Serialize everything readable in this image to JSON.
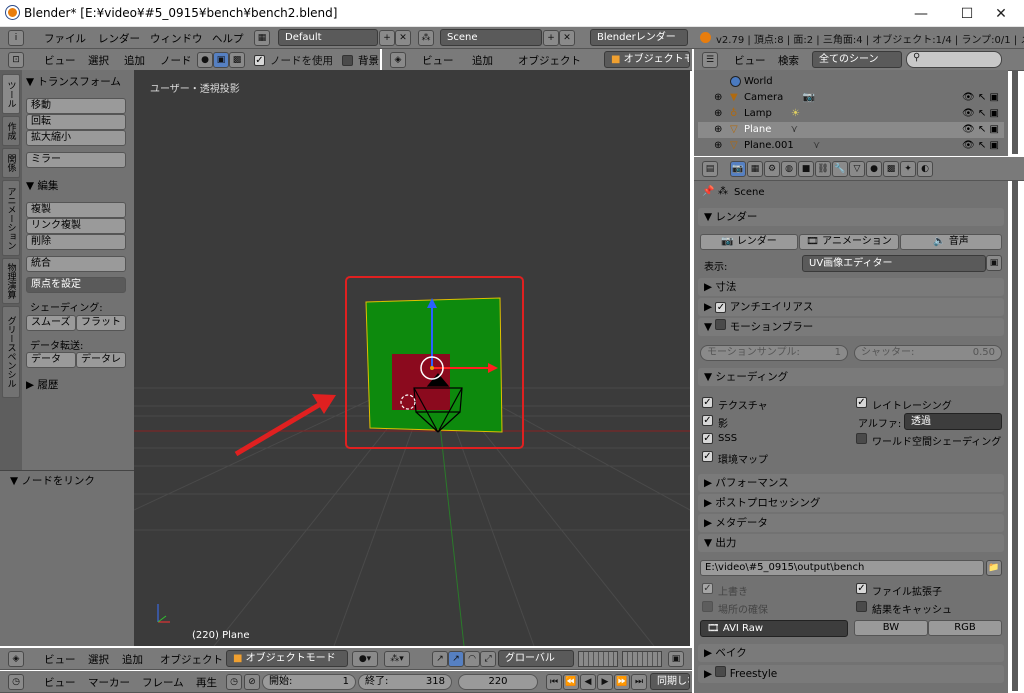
{
  "window": {
    "title": "Blender* [E:¥video¥#5_0915¥bench¥bench2.blend]",
    "minimize": "—",
    "maximize": "☐",
    "close": "✕"
  },
  "infobar": {
    "menus": [
      "ファイル",
      "レンダー",
      "ウィンドウ",
      "ヘルプ"
    ],
    "layout": "Default",
    "scene": "Scene",
    "engine": "Blenderレンダー",
    "stats": "v2.79 | 頂点:8 | 面:2 | 三角面:4 | オブジェクト:1/4 | ランプ:0/1 | メモリ:"
  },
  "node_header": {
    "menus": [
      "ビュー",
      "選択",
      "追加",
      "ノード"
    ],
    "use_nodes_label": "ノードを使用",
    "background_label": "背景"
  },
  "view3d_header_top": {
    "menus": [
      "ビュー",
      "追加",
      "オブジェクト"
    ],
    "mode": "オブジェクトモ"
  },
  "outliner_header": {
    "menus": [
      "ビュー",
      "検索"
    ],
    "filter": "全てのシーン"
  },
  "outliner": {
    "items": [
      {
        "name": "World"
      },
      {
        "name": "Camera"
      },
      {
        "name": "Lamp"
      },
      {
        "name": "Plane"
      },
      {
        "name": "Plane.001"
      }
    ]
  },
  "tool_tabs": [
    "ツール",
    "作成",
    "関係",
    "アニメーション",
    "物理演算",
    "グリースペンシル"
  ],
  "tool_panel": {
    "transform_title": "トランスフォーム",
    "move": "移動",
    "rotate": "回転",
    "scale": "拡大縮小",
    "mirror": "ミラー",
    "edit_title": "編集",
    "duplicate": "複製",
    "link_duplicate": "リンク複製",
    "delete": "削除",
    "join": "統合",
    "set_origin": "原点を設定",
    "shading_label": "シェーディング:",
    "smooth": "スムーズ",
    "flat": "フラット",
    "data_transfer_label": "データ転送:",
    "data": "データ",
    "data_layout": "データレ",
    "history_title": "履歴",
    "link_nodes_title": "ノードをリンク"
  },
  "viewport": {
    "view_label": "ユーザー・透視投影",
    "object_label": "(220) Plane"
  },
  "props": {
    "context": "Scene",
    "render_title": "レンダー",
    "render_btn": "レンダー",
    "anim_btn": "アニメーション",
    "audio_btn": "音声",
    "display_label": "表示:",
    "display_value": "UV画像エディター",
    "dimensions": "寸法",
    "antialias": "アンチエイリアス",
    "motion_blur": "モーションブラー",
    "motion_samples_label": "モーションサンプル:",
    "motion_samples_value": "1",
    "shutter_label": "シャッター:",
    "shutter_value": "0.50",
    "shading": "シェーディング",
    "textures": "テクスチャ",
    "raytracing": "レイトレーシング",
    "shadows": "影",
    "alpha_label": "アルファ:",
    "alpha_value": "透過",
    "sss": "SSS",
    "world_space_shading": "ワールド空間シェーディング",
    "env_map": "環境マップ",
    "performance": "パフォーマンス",
    "post_processing": "ポストプロセッシング",
    "metadata": "メタデータ",
    "output": "出力",
    "output_path": "E:\\video\\#5_0915\\output\\bench",
    "overwrite": "上書き",
    "file_extensions": "ファイル拡張子",
    "placeholders": "場所の確保",
    "cache_result": "結果をキャッシュ",
    "file_format": "AVI Raw",
    "bw": "BW",
    "rgb": "RGB",
    "bake": "ベイク",
    "freestyle": "Freestyle"
  },
  "view3d_footer": {
    "menus": [
      "ビュー",
      "選択",
      "追加",
      "オブジェクト"
    ],
    "mode": "オブジェクトモード",
    "orientation": "グローバル"
  },
  "timeline": {
    "menus": [
      "ビュー",
      "マーカー",
      "フレーム",
      "再生"
    ],
    "start_label": "開始:",
    "start_value": "1",
    "end_label": "終了:",
    "end_value": "318",
    "current": "220",
    "sync": "同期しな"
  },
  "colors": {
    "viewport_bg": "#3b3b3b",
    "plane_green": "#0d8a0d",
    "plane_red": "#8b0a1e",
    "highlight_red": "#e02020"
  }
}
